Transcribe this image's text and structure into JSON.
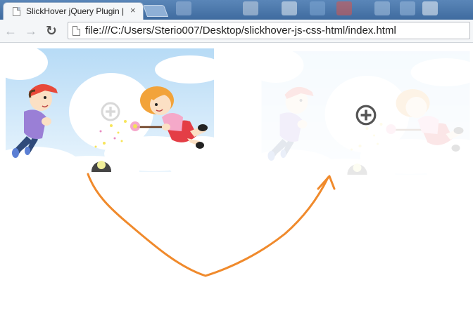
{
  "browser": {
    "tab": {
      "title": "SlickHover jQuery Plugin |",
      "close": "×"
    },
    "nav": {
      "back": "←",
      "forward": "→",
      "reload": "↻"
    },
    "address": "file:///C:/Users/Sterio007/Desktop/slickhover-js-css-html/index.html"
  },
  "demo": {
    "left_image": {
      "state": "normal",
      "icon": "zoom-plus-icon",
      "icon_opacity": 0.25
    },
    "right_image": {
      "state": "hover",
      "icon": "zoom-plus-icon",
      "icon_opacity": 1.0
    },
    "arrow": {
      "icon": "curved-arrow-icon",
      "color": "#f08a2c"
    }
  },
  "colors": {
    "tabstrip": "#4a77ab",
    "sky": "#cde6fa",
    "boy_shirt": "#9a7fd6",
    "boy_cap": "#e8493a",
    "girl_hair": "#f2a33a",
    "girl_dress": "#f5a9c9",
    "girl_skirt": "#e43e46"
  }
}
